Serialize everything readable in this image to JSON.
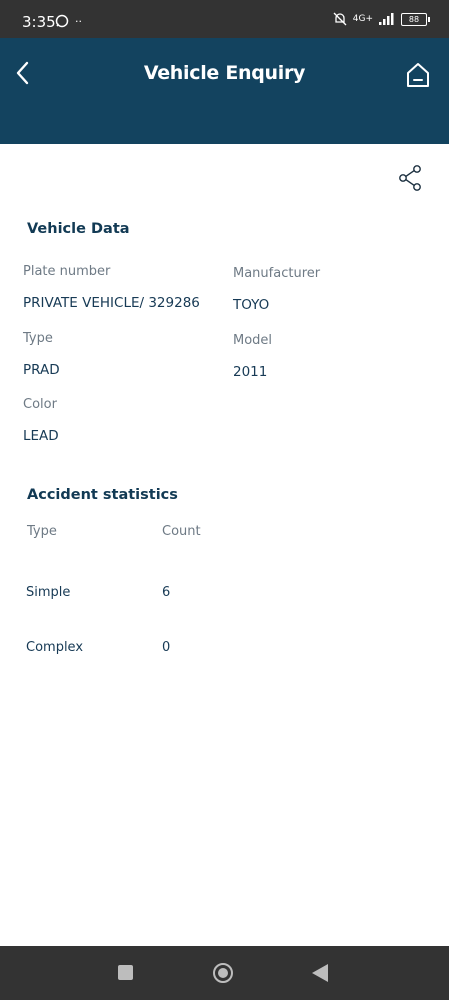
{
  "status_bar": {
    "time": "3:35",
    "network": "4G+",
    "battery": "88",
    "icons": [
      "whatsapp-icon",
      "dots-icon",
      "muted-bell-icon",
      "signal-icon",
      "battery-icon"
    ]
  },
  "header": {
    "title": "Vehicle Enquiry",
    "background_color": "#13435f",
    "icons": [
      "back-arrow-icon",
      "home-icon"
    ]
  },
  "toolbar": {
    "share_icon": "share-icon"
  },
  "vehicle_data": {
    "title": "Vehicle Data",
    "plate_number_label": "Plate number",
    "plate_number_value": "PRIVATE VEHICLE/ 329286",
    "manufacturer_label": "Manufacturer",
    "manufacturer_value": "TOYO",
    "type_label": "Type",
    "type_value": "PRAD",
    "model_label": "Model",
    "model_value": "2011",
    "color_label": "Color",
    "color_value": "LEAD"
  },
  "accident_statistics": {
    "title": "Accident statistics",
    "columns": [
      "Type",
      "Count"
    ],
    "rows": [
      {
        "type": "Simple",
        "count": "6"
      },
      {
        "type": "Complex",
        "count": "0"
      }
    ]
  },
  "navigation_bar": {
    "icons": [
      "recents-square-icon",
      "home-circle-icon",
      "back-triangle-icon"
    ]
  }
}
